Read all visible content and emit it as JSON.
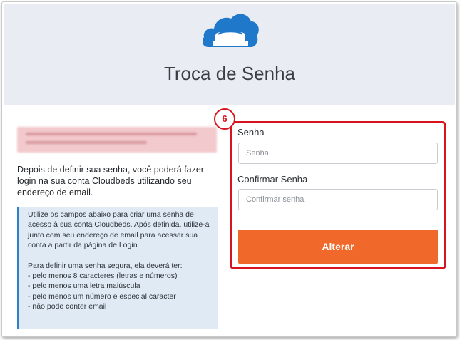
{
  "header": {
    "title": "Troca de Senha",
    "logo_icon": "cloudbeds-cloud-bed-logo",
    "background_color": "#e9ecf3",
    "logo_color": "#1f78c9"
  },
  "intro": {
    "text": "Depois de definir sua senha, você poderá fazer login na sua conta Cloudbeds utilizando seu endereço de email."
  },
  "info_box": {
    "paragraph1": "Utilize os campos abaixo para criar uma senha de acesso à sua conta Cloudbeds. Após definida, utilize-a junto com seu endereço de email para acessar sua conta a partir da página de Login.",
    "requirements_title": "Para definir uma senha segura, ela deverá ter:",
    "requirements": [
      "- pelo menos 8 caracteres (letras e números)",
      "- pelo menos uma letra maiúscula",
      "- pelo menos um número e especial caracter",
      "- não pode conter email"
    ]
  },
  "form": {
    "step_badge": "6",
    "password_label": "Senha",
    "password_placeholder": "Senha",
    "password_value": "",
    "confirm_label": "Confirmar Senha",
    "confirm_placeholder": "Confirmar senha",
    "confirm_value": "",
    "submit_label": "Alterar",
    "submit_color": "#f0682a",
    "highlight_color": "#d6131f"
  }
}
